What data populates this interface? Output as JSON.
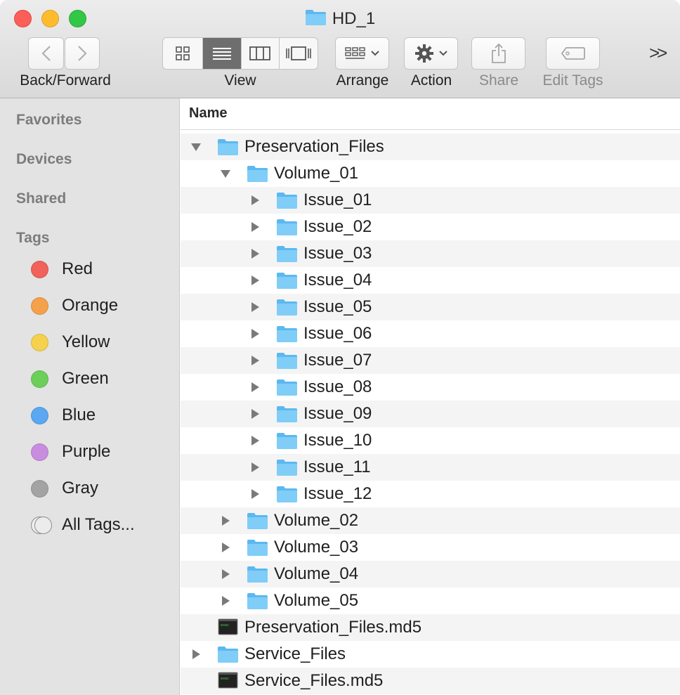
{
  "window": {
    "title": "HD_1"
  },
  "toolbar": {
    "back_forward_label": "Back/Forward",
    "view_label": "View",
    "arrange_label": "Arrange",
    "action_label": "Action",
    "share_label": "Share",
    "edit_tags_label": "Edit Tags",
    "more_glyph": ">>"
  },
  "sidebar": {
    "favorites": "Favorites",
    "devices": "Devices",
    "shared": "Shared",
    "tags_header": "Tags",
    "tags": [
      {
        "label": "Red",
        "color": "#f0625a"
      },
      {
        "label": "Orange",
        "color": "#f5a04a"
      },
      {
        "label": "Yellow",
        "color": "#f5d14e"
      },
      {
        "label": "Green",
        "color": "#6ccf5a"
      },
      {
        "label": "Blue",
        "color": "#5ba7f2"
      },
      {
        "label": "Purple",
        "color": "#c98de0"
      },
      {
        "label": "Gray",
        "color": "#a3a3a3"
      }
    ],
    "all_tags": "All Tags..."
  },
  "list": {
    "column_name": "Name",
    "rows": [
      {
        "name": "Preservation_Files",
        "kind": "folder",
        "disclosure": "open"
      },
      {
        "name": "Volume_01",
        "kind": "folder",
        "disclosure": "open"
      },
      {
        "name": "Issue_01",
        "kind": "folder",
        "disclosure": "closed"
      },
      {
        "name": "Issue_02",
        "kind": "folder",
        "disclosure": "closed"
      },
      {
        "name": "Issue_03",
        "kind": "folder",
        "disclosure": "closed"
      },
      {
        "name": "Issue_04",
        "kind": "folder",
        "disclosure": "closed"
      },
      {
        "name": "Issue_05",
        "kind": "folder",
        "disclosure": "closed"
      },
      {
        "name": "Issue_06",
        "kind": "folder",
        "disclosure": "closed"
      },
      {
        "name": "Issue_07",
        "kind": "folder",
        "disclosure": "closed"
      },
      {
        "name": "Issue_08",
        "kind": "folder",
        "disclosure": "closed"
      },
      {
        "name": "Issue_09",
        "kind": "folder",
        "disclosure": "closed"
      },
      {
        "name": "Issue_10",
        "kind": "folder",
        "disclosure": "closed"
      },
      {
        "name": "Issue_11",
        "kind": "folder",
        "disclosure": "closed"
      },
      {
        "name": "Issue_12",
        "kind": "folder",
        "disclosure": "closed"
      },
      {
        "name": "Volume_02",
        "kind": "folder",
        "disclosure": "closed"
      },
      {
        "name": "Volume_03",
        "kind": "folder",
        "disclosure": "closed"
      },
      {
        "name": "Volume_04",
        "kind": "folder",
        "disclosure": "closed"
      },
      {
        "name": "Volume_05",
        "kind": "folder",
        "disclosure": "closed"
      },
      {
        "name": "Preservation_Files.md5",
        "kind": "document",
        "disclosure": "none"
      },
      {
        "name": "Service_Files",
        "kind": "folder",
        "disclosure": "closed"
      },
      {
        "name": "Service_Files.md5",
        "kind": "document",
        "disclosure": "none"
      }
    ]
  }
}
